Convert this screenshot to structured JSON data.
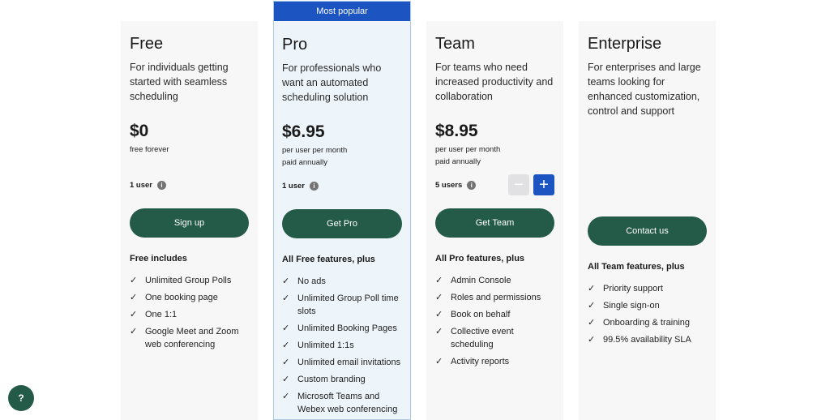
{
  "help": {
    "label": "?"
  },
  "plans": [
    {
      "name": "Free",
      "description": "For individuals getting started with seamless scheduling",
      "price": "$0",
      "price_note": "free forever",
      "users": "1 user",
      "cta": "Sign up",
      "includes_title": "Free includes",
      "features": [
        "Unlimited Group Polls",
        "One booking page",
        "One 1:1",
        "Google Meet and Zoom web conferencing"
      ]
    },
    {
      "name": "Pro",
      "badge": "Most popular",
      "description": "For professionals who want an automated scheduling solution",
      "price": "$6.95",
      "price_note": "per user per month\npaid annually",
      "users": "1 user",
      "cta": "Get Pro",
      "includes_title": "All Free features, plus",
      "features": [
        "No ads",
        "Unlimited Group Poll time slots",
        "Unlimited Booking Pages",
        "Unlimited 1:1s",
        "Unlimited email invitations",
        "Custom branding",
        "Microsoft Teams and Webex web conferencing"
      ]
    },
    {
      "name": "Team",
      "description": "For teams who need increased productivity and collaboration",
      "price": "$8.95",
      "price_note": "per user per month\npaid annually",
      "users": "5 users",
      "stepper": {
        "minus": "−",
        "plus": "+"
      },
      "cta": "Get Team",
      "includes_title": "All Pro features, plus",
      "features": [
        "Admin Console",
        "Roles and permissions",
        "Book on behalf",
        "Collective event scheduling",
        "Activity reports"
      ]
    },
    {
      "name": "Enterprise",
      "description": "For enterprises and large teams looking for enhanced customization, control and support",
      "price": "",
      "price_note": "",
      "users": "",
      "cta": "Contact us",
      "includes_title": "All Team features, plus",
      "features": [
        "Priority support",
        "Single sign-on",
        "Onboarding & training",
        "99.5% availability SLA"
      ]
    }
  ],
  "icons": {
    "check": "check-icon",
    "info": "info-icon",
    "help": "help-icon"
  },
  "colors": {
    "accent": "#1c54c2",
    "cta": "#235a48",
    "card": "#f7f7f8",
    "featured": "#edf5fb"
  }
}
